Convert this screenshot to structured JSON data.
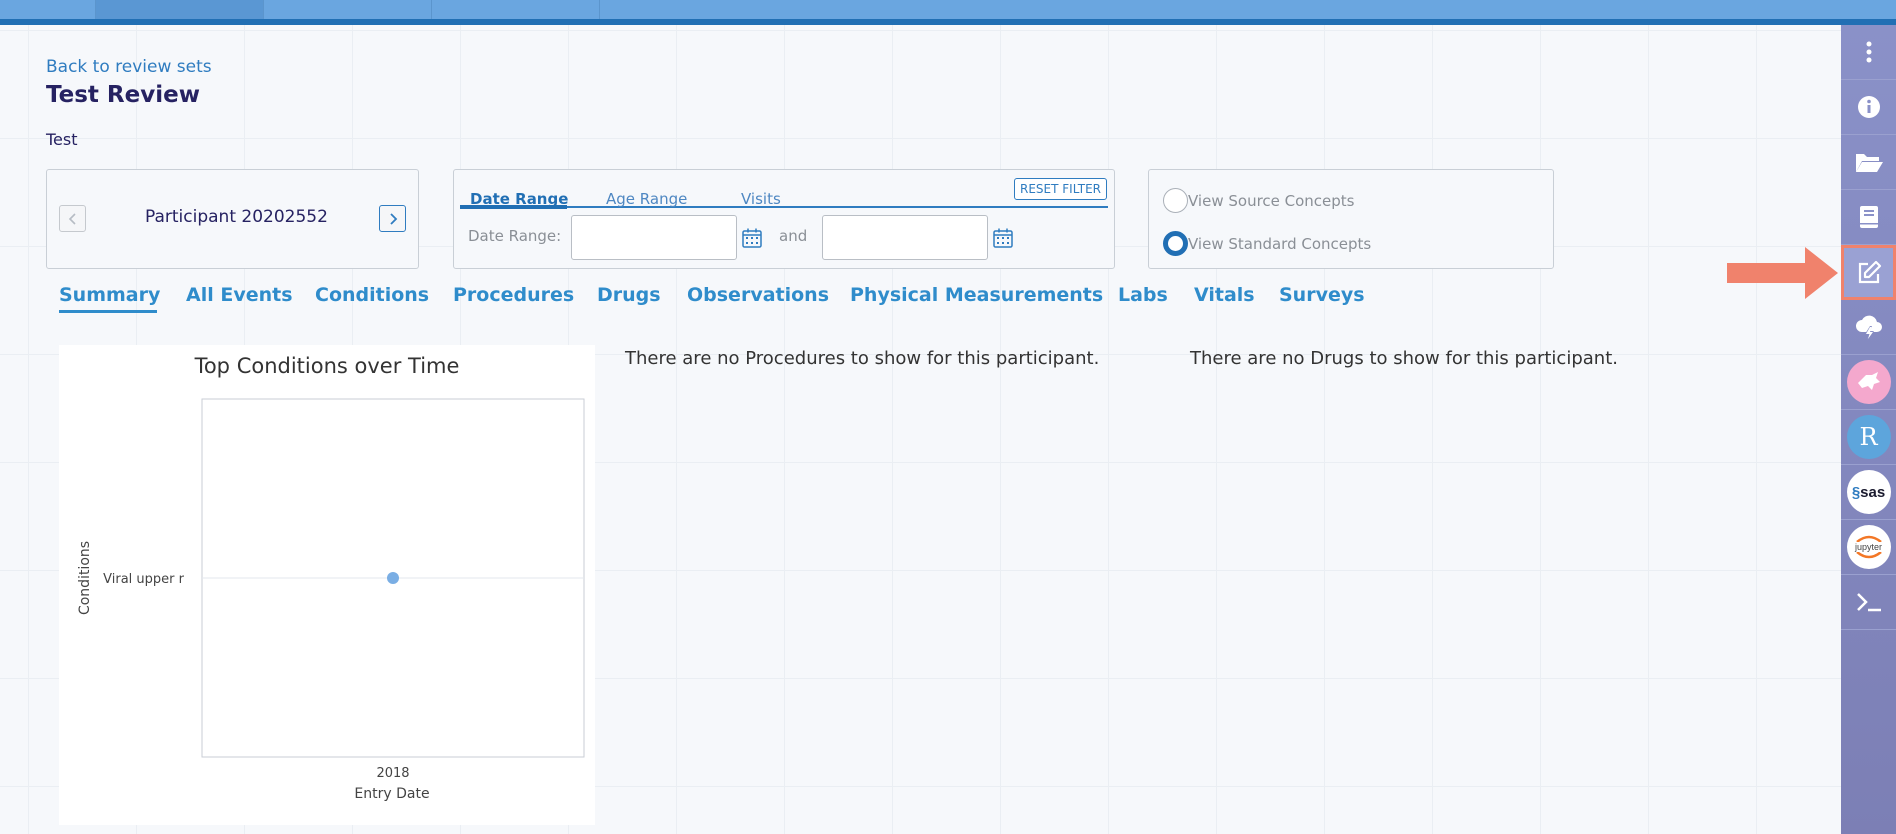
{
  "top_bar": {
    "tab_count": 4
  },
  "header": {
    "back_link": "Back to review sets",
    "title": "Test Review",
    "description": "Test"
  },
  "participant": {
    "label": "Participant 20202552",
    "prev_icon": "chevron-left-icon",
    "next_icon": "chevron-right-icon"
  },
  "filter": {
    "tabs": [
      "Date Range",
      "Age Range",
      "Visits"
    ],
    "active_tab": "Date Range",
    "reset_label": "RESET FILTER",
    "date_range_label": "Date Range:",
    "and_label": "and",
    "start_date": "",
    "end_date": ""
  },
  "concepts": {
    "options": [
      "View Source Concepts",
      "View Standard Concepts"
    ],
    "selected": "View Standard Concepts"
  },
  "main_tabs": [
    "Summary",
    "All Events",
    "Conditions",
    "Procedures",
    "Drugs",
    "Observations",
    "Physical Measurements",
    "Labs",
    "Vitals",
    "Surveys"
  ],
  "active_main_tab": "Summary",
  "messages": {
    "procedures": "There are no Procedures to show for this participant.",
    "drugs": "There are no Drugs to show for this participant."
  },
  "chart_data": {
    "type": "scatter",
    "title": "Top Conditions over Time",
    "xlabel": "Entry Date",
    "ylabel": "Conditions",
    "x_ticks": [
      "2018"
    ],
    "y_categories": [
      "Viral upper r"
    ],
    "points": [
      {
        "x": "2018",
        "y": "Viral upper r"
      }
    ],
    "grid": false
  },
  "sidebar": {
    "items": [
      "more-vertical-icon",
      "info-icon",
      "folder-open-icon",
      "book-icon",
      "edit-icon",
      "cloud-lightning-icon",
      "cromwell-icon",
      "r-icon",
      "sas-icon",
      "jupyter-icon",
      "terminal-icon"
    ],
    "selected": "edit-icon",
    "r_label": "R",
    "sas_label": "sas",
    "jupyter_label": "jupyter"
  },
  "colors": {
    "accent": "#216fb4",
    "tab_text": "#2f8ccb",
    "sidebar": "#8a91c8",
    "highlight": "#f0826c"
  }
}
